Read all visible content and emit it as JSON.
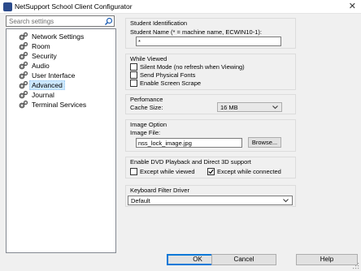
{
  "window": {
    "title": "NetSupport School Client Configurator",
    "close_glyph": "✕"
  },
  "search": {
    "placeholder": "Search settings"
  },
  "tree": {
    "items": [
      {
        "label": "Network Settings",
        "icon": "gear-icon"
      },
      {
        "label": "Room",
        "icon": "gear-icon"
      },
      {
        "label": "Security",
        "icon": "gear-icon"
      },
      {
        "label": "Audio",
        "icon": "gear-icon"
      },
      {
        "label": "User Interface",
        "icon": "gear-icon"
      },
      {
        "label": "Advanced",
        "icon": "gear-icon",
        "selected": true
      },
      {
        "label": "Journal",
        "icon": "gear-icon"
      },
      {
        "label": "Terminal Services",
        "icon": "gear-icon"
      }
    ]
  },
  "student_identification": {
    "title": "Student Identification",
    "name_label": "Student Name (* = machine name, ECWIN10-1):",
    "name_value": "*"
  },
  "while_viewed": {
    "title": "While Viewed",
    "silent_mode": {
      "label": "Silent Mode (no refresh when Viewing)",
      "checked": false
    },
    "send_fonts": {
      "label": "Send Physical Fonts",
      "checked": false
    },
    "screen_scrape": {
      "label": "Enable Screen Scrape",
      "checked": false
    }
  },
  "performance": {
    "title": "Perfomance",
    "cache_label": "Cache Size:",
    "cache_value": "16 MB"
  },
  "image_option": {
    "title": "Image Option",
    "file_label": "Image File:",
    "file_value": "nss_lock_image.jpg",
    "browse_label": "Browse..."
  },
  "dvd": {
    "title": "Enable DVD Playback and Direct 3D support",
    "except_viewed": {
      "label": "Except while viewed",
      "checked": false
    },
    "except_connected": {
      "label": "Except while connected",
      "checked": true
    }
  },
  "keyboard": {
    "title": "Keyboard Filter Driver",
    "value": "Default"
  },
  "buttons": {
    "ok": "OK",
    "cancel": "Cancel",
    "help": "Help"
  },
  "colors": {
    "selection": "#cce8ff",
    "accent": "#0078d7"
  }
}
